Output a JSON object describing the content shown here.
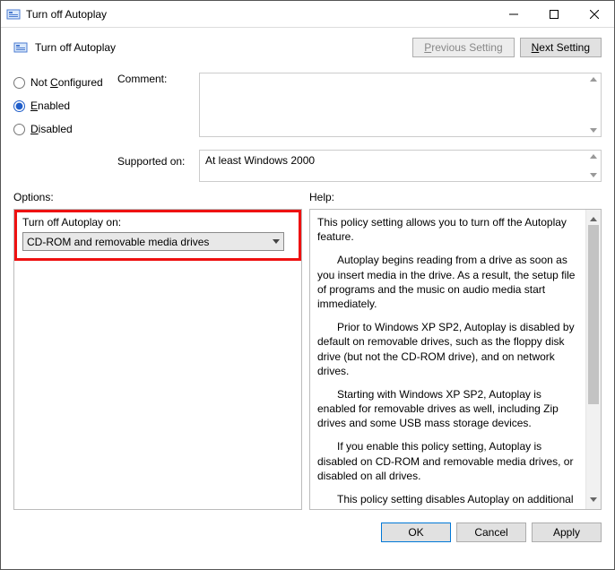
{
  "window": {
    "title": "Turn off Autoplay"
  },
  "header": {
    "title": "Turn off Autoplay",
    "prev": "Previous Setting",
    "next": "Next Setting"
  },
  "state": {
    "not_configured": "Not Configured",
    "enabled": "Enabled",
    "disabled": "Disabled",
    "selected": "enabled"
  },
  "comment": {
    "label": "Comment:",
    "value": ""
  },
  "supported": {
    "label": "Supported on:",
    "value": "At least Windows 2000"
  },
  "sections": {
    "options": "Options:",
    "help": "Help:"
  },
  "options": {
    "field_label": "Turn off Autoplay on:",
    "selected": "CD-ROM and removable media drives"
  },
  "help": {
    "p1": "This policy setting allows you to turn off the Autoplay feature.",
    "p2": "Autoplay begins reading from a drive as soon as you insert media in the drive. As a result, the setup file of programs and the music on audio media start immediately.",
    "p3": "Prior to Windows XP SP2, Autoplay is disabled by default on removable drives, such as the floppy disk drive (but not the CD-ROM drive), and on network drives.",
    "p4": "Starting with Windows XP SP2, Autoplay is enabled for removable drives as well, including Zip drives and some USB mass storage devices.",
    "p5": "If you enable this policy setting, Autoplay is disabled on CD-ROM and removable media drives, or disabled on all drives.",
    "p6": "This policy setting disables Autoplay on additional types of drives. You cannot use this setting to enable Autoplay on drives on which it is disabled by default."
  },
  "footer": {
    "ok": "OK",
    "cancel": "Cancel",
    "apply": "Apply"
  }
}
